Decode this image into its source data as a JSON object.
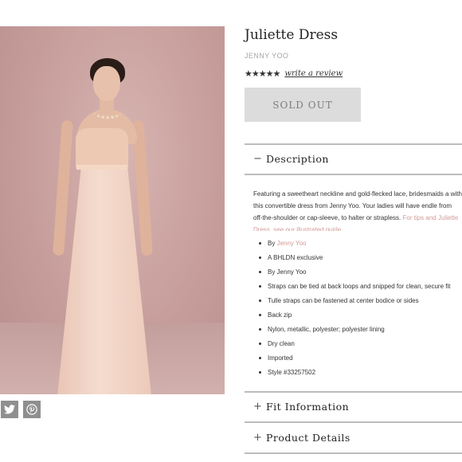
{
  "product": {
    "title": "Juliette Dress",
    "brand": "JENNY YOO",
    "stars": "★★★★★",
    "write_review": "write a review",
    "sold_out": "SOLD OUT"
  },
  "description": {
    "heading": "Description",
    "sign": "−",
    "text": "Featuring a sweetheart neckline and gold-flecked lace, bridesmaids a with this convertible dress from Jenny Yoo. Your ladies will have endle from off-the-shoulder or cap-sleeve, to halter or strapless. ",
    "link": "For tips and Juliette Dress, see our illustrated guide.",
    "bullets": [
      {
        "prefix": "By ",
        "link": "Jenny Yoo"
      },
      {
        "text": "A BHLDN exclusive"
      },
      {
        "text": "By Jenny Yoo"
      },
      {
        "text": "Straps can be tied at back loops and snipped for clean, secure fit"
      },
      {
        "text": "Tulle straps can be fastened at center bodice or sides"
      },
      {
        "text": "Back zip"
      },
      {
        "text": "Nylon, metallic, polyester; polyester lining"
      },
      {
        "text": "Dry clean"
      },
      {
        "text": "Imported"
      },
      {
        "text": "Style #33257502"
      }
    ]
  },
  "fit": {
    "heading": "Fit Information",
    "sign": "+"
  },
  "details": {
    "heading": "Product Details",
    "sign": "+"
  },
  "share": {
    "twitter": "twitter-icon",
    "pinterest": "pinterest-icon"
  },
  "colors": {
    "link_pink": "#d49a98",
    "soldout_bg": "#dcdcdc",
    "share_gray": "#8f8f8f"
  }
}
